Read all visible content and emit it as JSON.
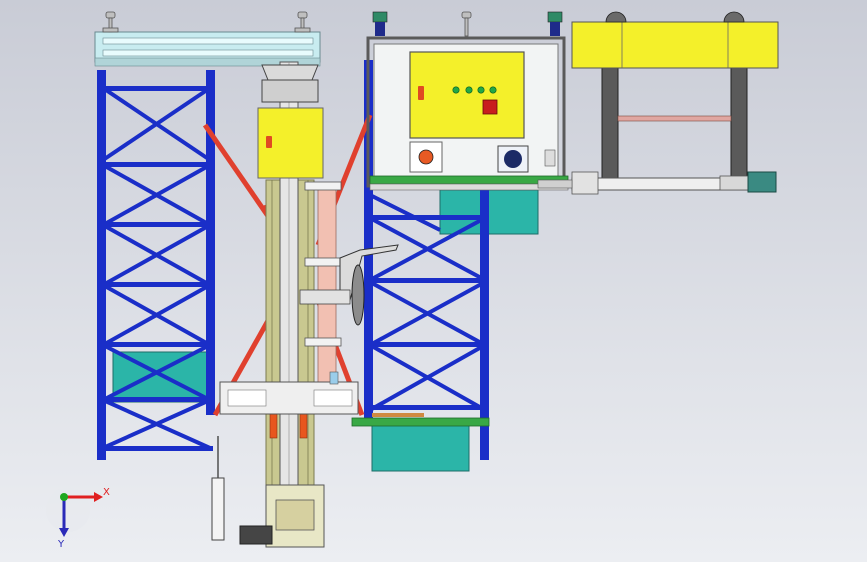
{
  "viewport": {
    "background_top": "#c9ccd6",
    "background_bottom": "#eceef2"
  },
  "colors": {
    "rack_blue": "#1a2ec8",
    "rack_blue_dark": "#0d1a8a",
    "brace_red": "#e0402e",
    "frame_cyan": "#c8ecf0",
    "panel_yellow": "#f4f02a",
    "bin_teal": "#2bb5a8",
    "rail_green": "#39a845",
    "column_olive": "#c9c890",
    "steel_grey": "#5a5a5a",
    "light_grey": "#d8d8d8"
  },
  "triad": {
    "x_label": "X",
    "y_label": "Y",
    "x_color": "#e02020",
    "y_color": "#2a2ab8",
    "origin_color": "#1fa81f"
  }
}
